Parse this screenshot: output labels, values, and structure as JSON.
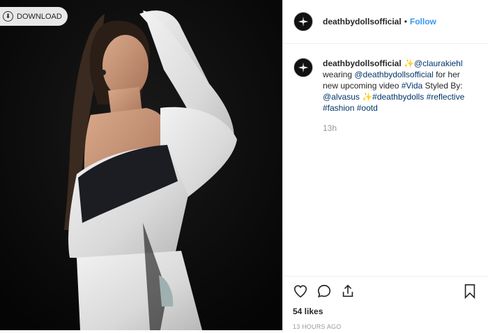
{
  "image": {
    "download_label": "DOWNLOAD"
  },
  "header": {
    "username": "deathbydollsofficial",
    "separator": "•",
    "follow_label": "Follow"
  },
  "caption": {
    "username": "deathbydollsofficial",
    "parts": [
      {
        "text": " ✨",
        "tag": false
      },
      {
        "text": "@claurakiehl",
        "tag": true
      },
      {
        "text": " wearing ",
        "tag": false
      },
      {
        "text": "@deathbydollsofficial",
        "tag": true
      },
      {
        "text": " for her new upcoming video ",
        "tag": false
      },
      {
        "text": "#Vida",
        "tag": true
      },
      {
        "text": " Styled By: ",
        "tag": false
      },
      {
        "text": "@alvasus",
        "tag": true
      },
      {
        "text": " ✨",
        "tag": false
      },
      {
        "text": "#deathbydolls",
        "tag": true
      },
      {
        "text": " ",
        "tag": false
      },
      {
        "text": "#reflective",
        "tag": true
      },
      {
        "text": " ",
        "tag": false
      },
      {
        "text": "#fashion",
        "tag": true
      },
      {
        "text": " ",
        "tag": false
      },
      {
        "text": "#ootd",
        "tag": true
      }
    ],
    "time": "13h"
  },
  "actions": {
    "likes": "54 likes",
    "timestamp": "13 HOURS AGO"
  },
  "icons": [
    "download-icon",
    "heart-icon",
    "comment-icon",
    "share-icon",
    "bookmark-icon"
  ]
}
